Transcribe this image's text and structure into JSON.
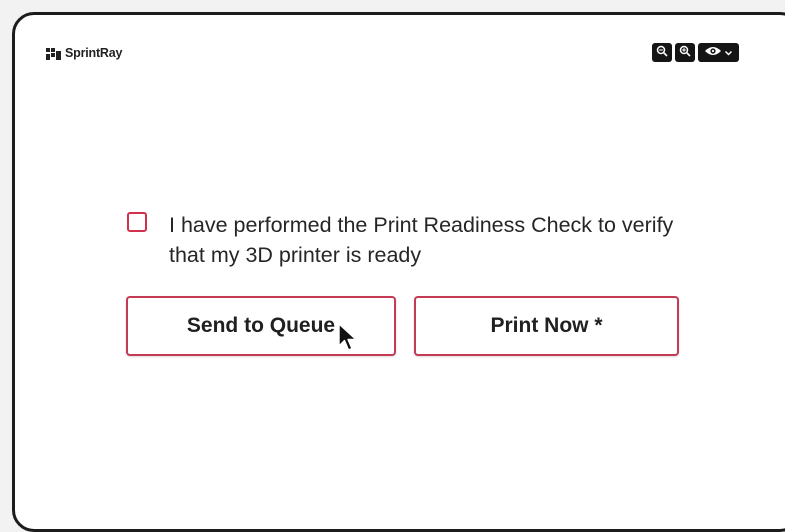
{
  "header": {
    "brand_name": "SprintRay",
    "brand_icon": "sprintray-logo-icon",
    "tools": [
      {
        "icon": "zoom-out-icon"
      },
      {
        "icon": "zoom-in-icon"
      },
      {
        "icon": "eye-icon",
        "dropdown_icon": "chevron-down-icon"
      }
    ]
  },
  "main": {
    "readiness_checkbox": {
      "checked": false,
      "label": "I have performed the Print Readiness Check to verify that my 3D printer is ready"
    },
    "send_to_queue_label": "Send to Queue",
    "print_now_label": "Print Now *"
  },
  "colors": {
    "accent": "#c73a55",
    "toolbar_bg": "#151515",
    "text": "#262626"
  }
}
